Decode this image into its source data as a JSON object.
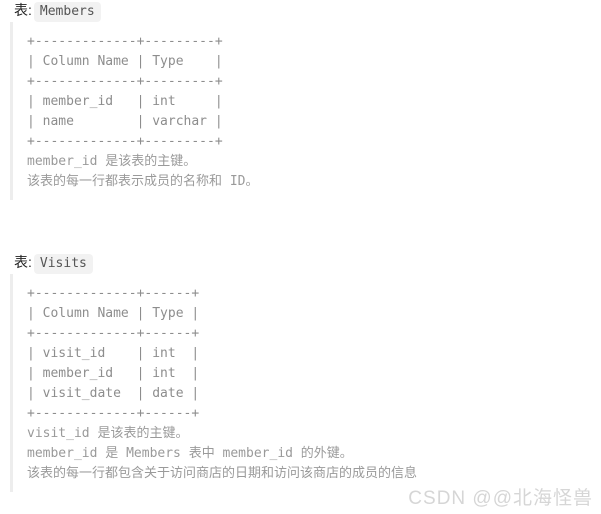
{
  "document": {
    "background_color": "#ffffff",
    "text_color": "#8d8d8d",
    "badge_bg_color": "#f2f2f2",
    "border_color": "#ededed"
  },
  "sections": [
    {
      "label_prefix": "表:",
      "table_name": "Members",
      "ascii_schema": "+-------------+---------+\n| Column Name | Type    |\n+-------------+---------+\n| member_id   | int     |\n| name        | varchar |\n+-------------+---------+",
      "descriptions": [
        "member_id 是该表的主键。",
        "该表的每一行都表示成员的名称和 ID。"
      ]
    },
    {
      "label_prefix": "表:",
      "table_name": "Visits",
      "ascii_schema": "+-------------+------+\n| Column Name | Type |\n+-------------+------+\n| visit_id    | int  |\n| member_id   | int  |\n| visit_date  | date |\n+-------------+------+",
      "descriptions": [
        "visit_id 是该表的主键。",
        "member_id 是 Members 表中 member_id 的外键。",
        "该表的每一行都包含关于访问商店的日期和访问该商店的成员的信息"
      ]
    }
  ],
  "watermark": {
    "text": "CSDN @@北海怪兽"
  },
  "chart_data": {
    "type": "table",
    "title": "Table Schemas",
    "tables": [
      {
        "name": "Members",
        "columns": [
          "Column Name",
          "Type"
        ],
        "rows": [
          [
            "member_id",
            "int"
          ],
          [
            "name",
            "varchar"
          ]
        ],
        "primary_key": "member_id",
        "notes": [
          "member_id 是该表的主键。",
          "该表的每一行都表示成员的名称和 ID。"
        ]
      },
      {
        "name": "Visits",
        "columns": [
          "Column Name",
          "Type"
        ],
        "rows": [
          [
            "visit_id",
            "int"
          ],
          [
            "member_id",
            "int"
          ],
          [
            "visit_date",
            "date"
          ]
        ],
        "primary_key": "visit_id",
        "foreign_keys": [
          {
            "column": "member_id",
            "references_table": "Members",
            "references_column": "member_id"
          }
        ],
        "notes": [
          "visit_id 是该表的主键。",
          "member_id 是 Members 表中 member_id 的外键。",
          "该表的每一行都包含关于访问商店的日期和访问该商店的成员的信息"
        ]
      }
    ]
  }
}
